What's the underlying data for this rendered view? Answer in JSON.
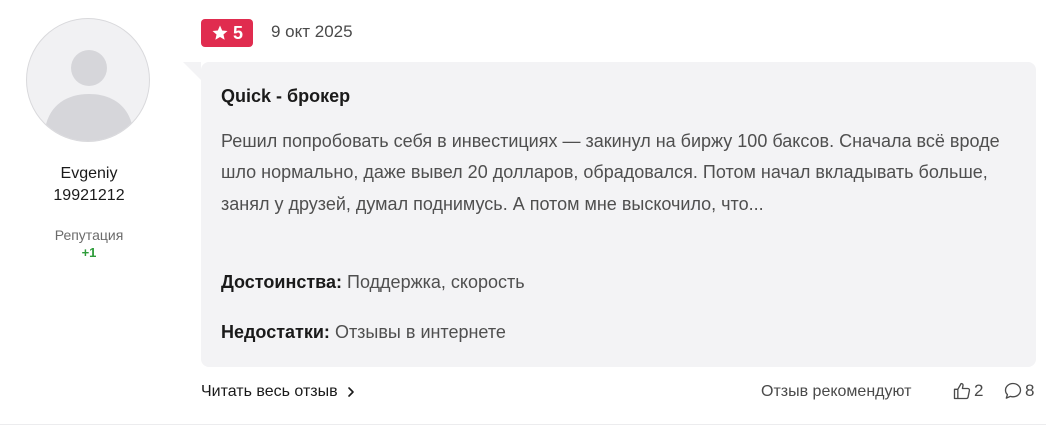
{
  "user": {
    "name_line1": "Evgeniy",
    "name_line2": "19921212",
    "reputation_label": "Репутация",
    "reputation_value": "+1"
  },
  "review": {
    "rating": "5",
    "date": "9 окт 2025",
    "title": "Quick - брокер",
    "text": "Решил попробовать себя в инвестициях — закинул на биржу 100 баксов. Сначала всё вроде шло нормально, даже вывел 20 долларов, обрадовался. Потом начал вкладывать больше, занял у друзей, думал поднимусь. А потом мне выскочило, что...",
    "pros_label": "Достоинства:",
    "pros_value": "Поддержка, скорость",
    "cons_label": "Недостатки:",
    "cons_value": "Отзывы в интернете"
  },
  "footer": {
    "read_more": "Читать весь отзыв",
    "recommend_label": "Отзыв рекомендуют",
    "likes": "2",
    "comments": "8"
  },
  "colors": {
    "badge": "#e02c4f",
    "card_bg": "#f3f3f5",
    "reputation": "#2e9c3a"
  },
  "icons": {
    "rating": "star-icon",
    "read_more": "chevron-right-icon",
    "likes": "thumbs-up-icon",
    "comments": "comment-bubble-icon",
    "avatar": "user-silhouette-icon"
  }
}
